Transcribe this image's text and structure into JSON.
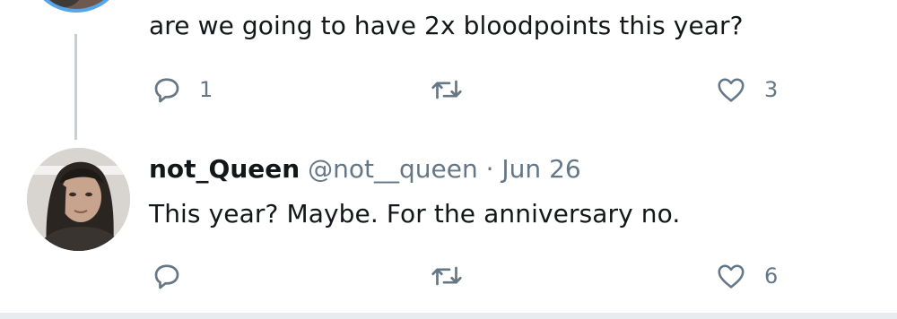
{
  "thread": {
    "previous_tweet": {
      "text": "are we going to have 2x bloodpoints this year?",
      "actions": {
        "reply_count": "1",
        "retweet_count": "",
        "like_count": "3"
      }
    },
    "reply_tweet": {
      "display_name": "not_Queen",
      "handle": "@not__queen",
      "separator": "·",
      "date": "Jun 26",
      "text": "This year? Maybe. For the anniversary no.",
      "actions": {
        "reply_count": "",
        "retweet_count": "",
        "like_count": "6"
      }
    }
  },
  "icons": {
    "reply": "reply-icon",
    "retweet": "retweet-icon",
    "like": "heart-icon"
  },
  "colors": {
    "text_primary": "#14171a",
    "text_secondary": "#657786",
    "thread_line": "#c4cfd6",
    "avatar_ring": "#55a5e8",
    "divider": "#e6ecf0"
  }
}
